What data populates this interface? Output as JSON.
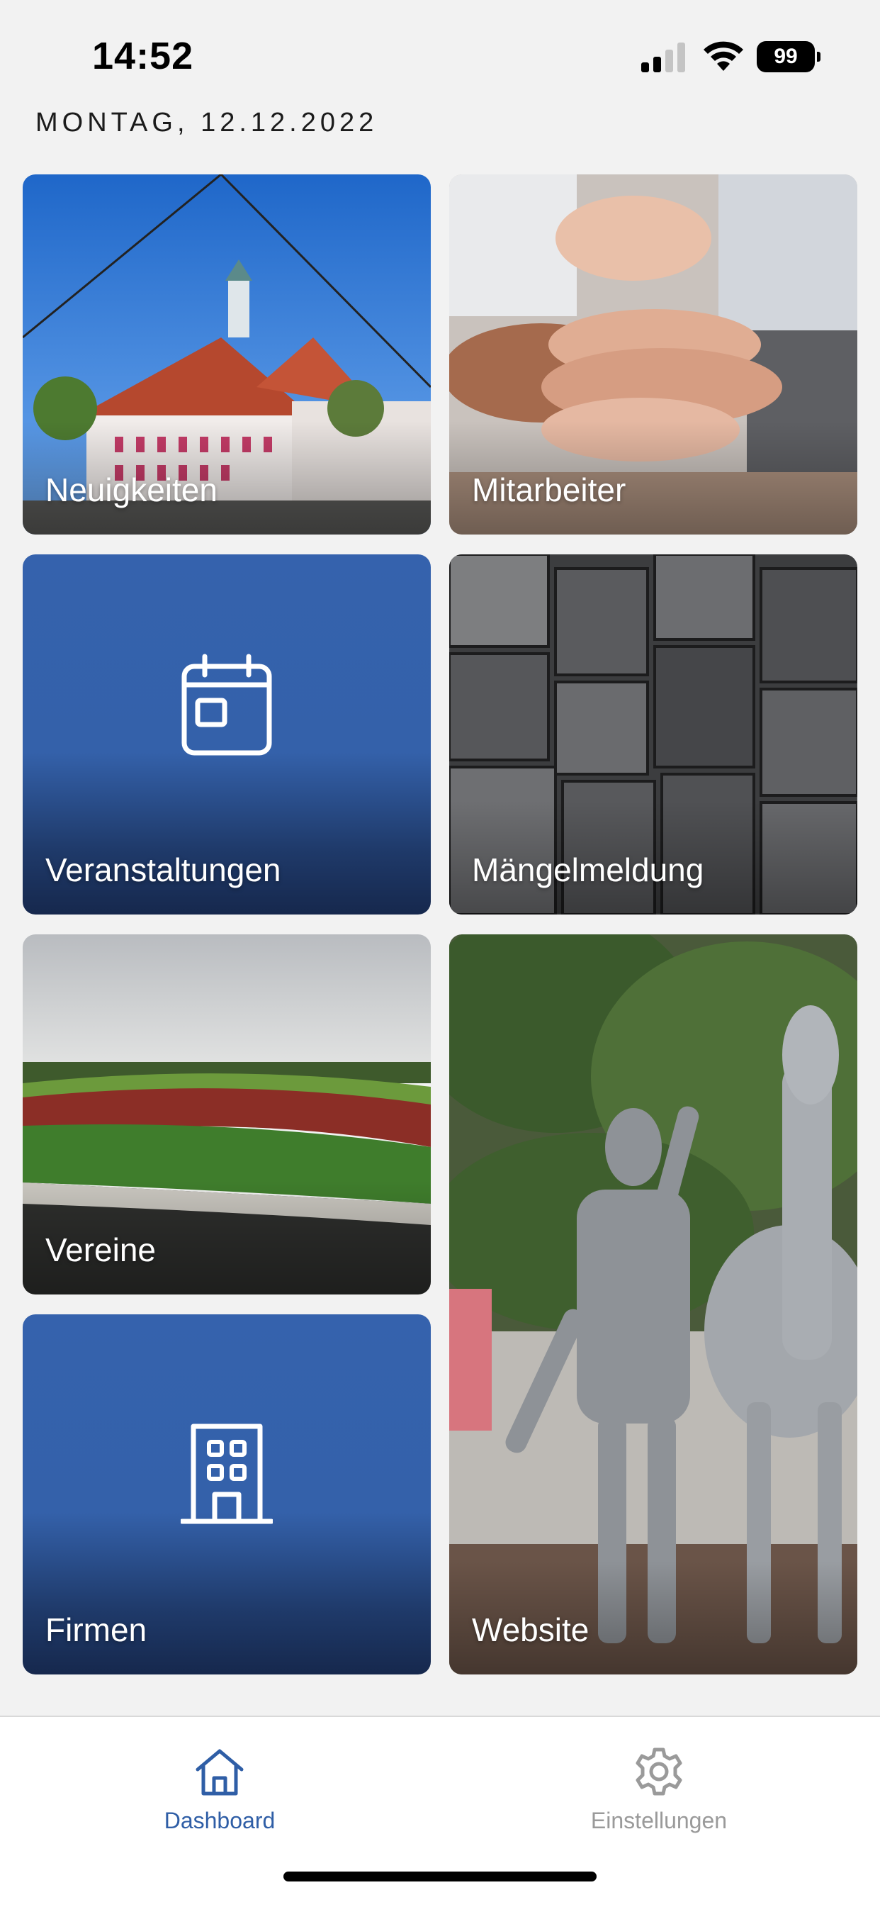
{
  "status_bar": {
    "time": "14:52",
    "battery": "99",
    "icons": [
      "cellular-signal-icon",
      "wifi-icon",
      "battery-icon"
    ]
  },
  "header": {
    "date": "MONTAG, 12.12.2022"
  },
  "tiles": [
    {
      "label": "Neuigkeiten",
      "kind": "photo",
      "image": "town-hall-photo"
    },
    {
      "label": "Mitarbeiter",
      "kind": "photo",
      "image": "stacked-hands-photo"
    },
    {
      "label": "Veranstaltungen",
      "kind": "icon",
      "icon": "calendar-icon"
    },
    {
      "label": "Mängelmeldung",
      "kind": "photo",
      "image": "paving-stones-photo"
    },
    {
      "label": "Vereine",
      "kind": "photo",
      "image": "sports-stadium-photo"
    },
    {
      "label": "Firmen",
      "kind": "icon",
      "icon": "building-icon"
    },
    {
      "label": "Website",
      "kind": "photo",
      "image": "statue-photo"
    }
  ],
  "tab_bar": {
    "items": [
      {
        "label": "Dashboard",
        "icon": "home-icon",
        "active": true
      },
      {
        "label": "Einstellungen",
        "icon": "gear-icon",
        "active": false
      }
    ]
  },
  "colors": {
    "tile_blue": "#3562ad",
    "tile_blue_dark": "#16284d",
    "active_tab": "#2f5ea6",
    "inactive_tab": "#9a9a9a",
    "background": "#f2f2f2"
  }
}
